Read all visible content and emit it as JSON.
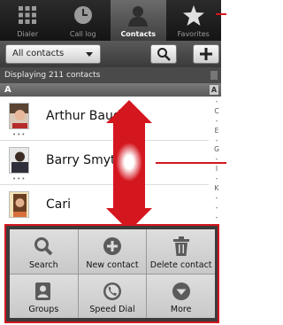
{
  "tabs": [
    {
      "label": "Dialer",
      "icon": "dialpad-icon"
    },
    {
      "label": "Call log",
      "icon": "clock-icon"
    },
    {
      "label": "Contacts",
      "icon": "person-icon",
      "active": true
    },
    {
      "label": "Favorites",
      "icon": "star-icon"
    }
  ],
  "toolbar": {
    "filter_value": "All contacts"
  },
  "info": {
    "count_text": "Displaying 211 contacts"
  },
  "section": {
    "letter": "A",
    "index_letter": "A"
  },
  "contacts": [
    {
      "name": "Arthur Baudo"
    },
    {
      "name": "Barry Smyth"
    },
    {
      "name": "Cari"
    }
  ],
  "alphabet": [
    "-",
    "C",
    "-",
    "E",
    "-",
    "G",
    "-",
    "I",
    "-",
    "K",
    "-",
    "-",
    "-"
  ],
  "menu": {
    "items": [
      {
        "label": "Search",
        "icon": "search-icon"
      },
      {
        "label": "New contact",
        "icon": "plus-circle-icon"
      },
      {
        "label": "Delete contact",
        "icon": "trash-icon"
      },
      {
        "label": "Groups",
        "icon": "groups-icon"
      },
      {
        "label": "Speed Dial",
        "icon": "phone-icon"
      },
      {
        "label": "More",
        "icon": "more-icon"
      }
    ]
  },
  "colors": {
    "callout": "#d4161f",
    "tab_active": "#5a5a5a"
  }
}
